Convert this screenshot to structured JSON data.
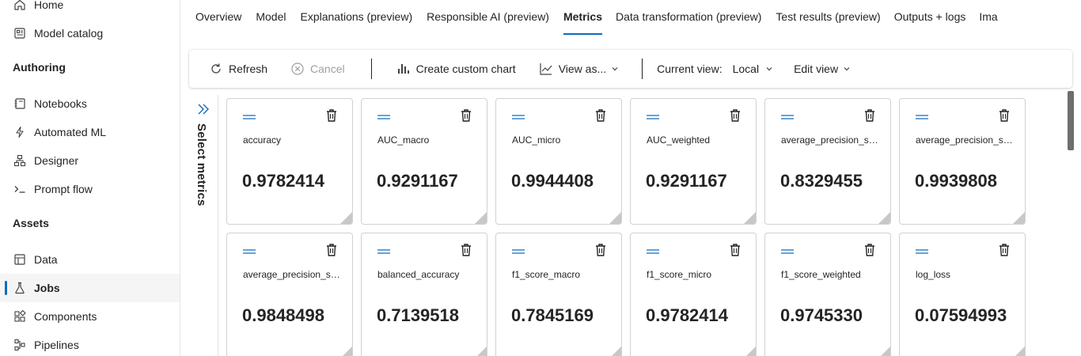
{
  "sidebar": {
    "top_items": [
      {
        "label": "Home",
        "icon": "home-icon"
      },
      {
        "label": "Model catalog",
        "icon": "model-catalog-icon"
      }
    ],
    "sections": [
      {
        "title": "Authoring",
        "items": [
          {
            "label": "Notebooks",
            "icon": "notebook-icon"
          },
          {
            "label": "Automated ML",
            "icon": "automl-icon"
          },
          {
            "label": "Designer",
            "icon": "designer-icon"
          },
          {
            "label": "Prompt flow",
            "icon": "prompt-flow-icon"
          }
        ]
      },
      {
        "title": "Assets",
        "items": [
          {
            "label": "Data",
            "icon": "data-icon"
          },
          {
            "label": "Jobs",
            "icon": "jobs-icon",
            "active": true
          },
          {
            "label": "Components",
            "icon": "components-icon"
          },
          {
            "label": "Pipelines",
            "icon": "pipelines-icon"
          }
        ]
      }
    ]
  },
  "tabs": [
    "Overview",
    "Model",
    "Explanations (preview)",
    "Responsible AI (preview)",
    "Metrics",
    "Data transformation (preview)",
    "Test results (preview)",
    "Outputs + logs",
    "Ima"
  ],
  "active_tab": "Metrics",
  "toolbar": {
    "refresh": "Refresh",
    "cancel": "Cancel",
    "create_chart": "Create custom chart",
    "view_as": "View as...",
    "current_view_label": "Current view:",
    "current_view_value": "Local",
    "edit_view": "Edit view"
  },
  "select_metrics_label": "Select metrics",
  "metrics": [
    {
      "name": "accuracy",
      "value": "0.9782414"
    },
    {
      "name": "AUC_macro",
      "value": "0.9291167"
    },
    {
      "name": "AUC_micro",
      "value": "0.9944408"
    },
    {
      "name": "AUC_weighted",
      "value": "0.9291167"
    },
    {
      "name": "average_precision_sco...",
      "value": "0.8329455"
    },
    {
      "name": "average_precision_sco...",
      "value": "0.9939808"
    },
    {
      "name": "average_precision_sco...",
      "value": "0.9848498"
    },
    {
      "name": "balanced_accuracy",
      "value": "0.7139518"
    },
    {
      "name": "f1_score_macro",
      "value": "0.7845169"
    },
    {
      "name": "f1_score_micro",
      "value": "0.9782414"
    },
    {
      "name": "f1_score_weighted",
      "value": "0.9745330"
    },
    {
      "name": "log_loss",
      "value": "0.07594993"
    }
  ],
  "colors": {
    "accent": "#0f6cbd",
    "text": "#242424",
    "disabled": "#a0a0a0"
  }
}
